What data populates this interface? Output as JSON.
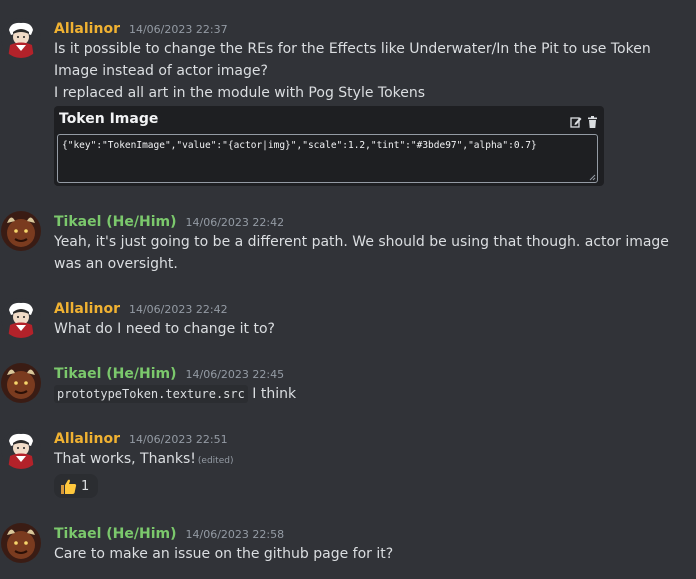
{
  "colors": {
    "allalinor": "#f0b232",
    "tikael": "#7bc86c",
    "background": "#313338",
    "embed_bg": "#1e1f22"
  },
  "messages": [
    {
      "author": "Allalinor",
      "timestamp": "14/06/2023 22:37",
      "lines": [
        "Is it possible to change the REs for the Effects like Underwater/In the Pit to use Token Image instead of actor image?",
        "I replaced all art in the module with Pog Style Tokens"
      ],
      "embed": {
        "title": "Token Image",
        "icons": [
          "edit-icon",
          "trash-icon"
        ],
        "code": "{\"key\":\"TokenImage\",\"value\":\"{actor|img}\",\"scale\":1.2,\"tint\":\"#3bde97\",\"alpha\":0.7}"
      }
    },
    {
      "author": "Tikael (He/Him)",
      "timestamp": "14/06/2023 22:42",
      "lines": [
        "Yeah, it's just going to be a different path. We should be using that though. actor image was an oversight."
      ]
    },
    {
      "author": "Allalinor",
      "timestamp": "14/06/2023 22:42",
      "lines": [
        "What do I need to change it to?"
      ]
    },
    {
      "author": "Tikael (He/Him)",
      "timestamp": "14/06/2023 22:45",
      "code": "prototypeToken.texture.src",
      "after_code": " I think"
    },
    {
      "author": "Allalinor",
      "timestamp": "14/06/2023 22:51",
      "lines": [
        "That works, Thanks!"
      ],
      "edited": "(edited)",
      "reaction": {
        "emoji": "thumbs-up-icon",
        "count": "1"
      }
    },
    {
      "author": "Tikael (He/Him)",
      "timestamp": "14/06/2023 22:58",
      "lines": [
        "Care to make an issue on the github page for it?"
      ]
    }
  ]
}
